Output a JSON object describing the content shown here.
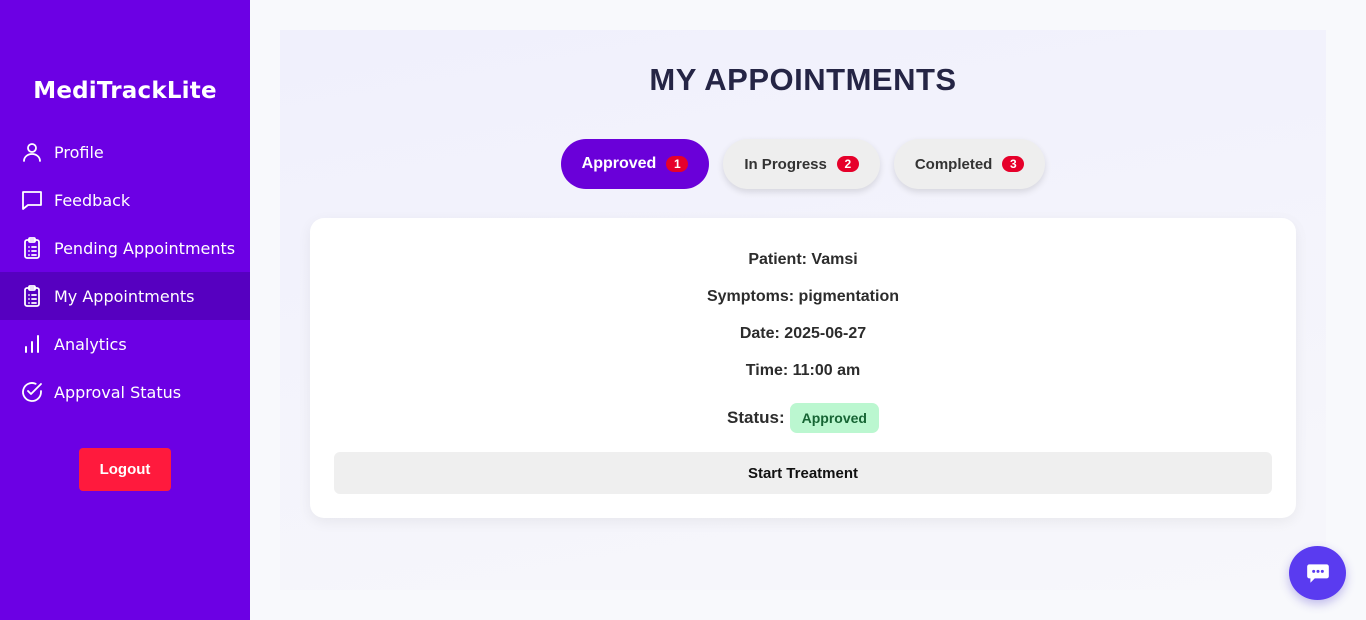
{
  "app": {
    "brand": "MediTrackLite"
  },
  "sidebar": {
    "items": [
      {
        "label": "Profile",
        "icon": "user-icon",
        "active": false
      },
      {
        "label": "Feedback",
        "icon": "message-square-icon",
        "active": false
      },
      {
        "label": "Pending Appointments",
        "icon": "clipboard-list-icon",
        "active": false
      },
      {
        "label": "My Appointments",
        "icon": "clipboard-list-icon",
        "active": true
      },
      {
        "label": "Analytics",
        "icon": "bar-chart-icon",
        "active": false
      },
      {
        "label": "Approval Status",
        "icon": "check-circle-icon",
        "active": false
      }
    ],
    "logout_label": "Logout"
  },
  "main": {
    "title": "MY APPOINTMENTS",
    "tabs": [
      {
        "label": "Approved",
        "count": "1",
        "active": true
      },
      {
        "label": "In Progress",
        "count": "2",
        "active": false
      },
      {
        "label": "Completed",
        "count": "3",
        "active": false
      }
    ],
    "appointment": {
      "patient": "Patient: Vamsi",
      "symptoms": "Symptoms: pigmentation",
      "date": "Date: 2025-06-27",
      "time": "Time: 11:00 am",
      "status_label": "Status:",
      "status_value": "Approved",
      "action_label": "Start Treatment"
    }
  },
  "colors": {
    "sidebar_bg": "#6c00e4",
    "sidebar_active_bg": "#5600c0",
    "tab_active_bg": "#6a00d9",
    "badge_red": "#e6002a",
    "logout_red": "#ff1a3d",
    "status_green_bg": "#bbf7d0",
    "status_green_text": "#166534",
    "chat_fab": "#5a3bf0"
  },
  "chat": {
    "icon": "chat-bubble-icon"
  }
}
